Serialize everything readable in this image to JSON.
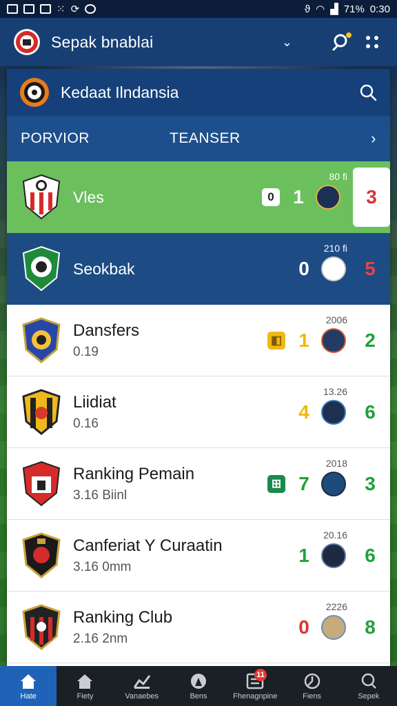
{
  "status_bar": {
    "battery": "71%",
    "time": "0:30"
  },
  "app_bar": {
    "title": "Sepak bnablai"
  },
  "league": {
    "title": "Kedaat Ilndansia"
  },
  "tabs": {
    "left": "PORVIOR",
    "right": "TEANSER"
  },
  "matches": [
    {
      "name": "Vles",
      "sub": "",
      "year": "80 fi",
      "badge": "0",
      "score1": "1",
      "score2": "3",
      "style": "green"
    },
    {
      "name": "Seokbak",
      "sub": "",
      "year": "210 fi",
      "badge": "",
      "score1": "0",
      "score2": "5",
      "style": "blue"
    },
    {
      "name": "Dansfers",
      "sub": "0.19",
      "year": "2006",
      "badge": "",
      "score1": "1",
      "score2": "2",
      "style": "white"
    },
    {
      "name": "Liidiat",
      "sub": "0.16",
      "year": "13.26",
      "badge": "",
      "score1": "4",
      "score2": "6",
      "style": "white"
    },
    {
      "name": "Ranking Pemain",
      "sub": "3.16  Biinl",
      "year": "2018",
      "badge": "",
      "score1": "7",
      "score2": "3",
      "style": "white"
    },
    {
      "name": "Canferiat Y Curaatin",
      "sub": "3.16  0mm",
      "year": "20.16",
      "badge": "",
      "score1": "1",
      "score2": "6",
      "style": "white"
    },
    {
      "name": "Ranking Club",
      "sub": "2.16  2nm",
      "year": "2226",
      "badge": "",
      "score1": "0",
      "score2": "8",
      "style": "white"
    }
  ],
  "bottom_nav": [
    {
      "label": "Hate"
    },
    {
      "label": "Fiety"
    },
    {
      "label": "Vanaebes"
    },
    {
      "label": "Bens"
    },
    {
      "label": "Fhenagnpine",
      "badge": "11"
    },
    {
      "label": "Fiens"
    },
    {
      "label": "Sepek"
    }
  ],
  "colors": {
    "app_bar": "#173f74",
    "header": "#16407a",
    "tabs": "#1d4f8c",
    "green_row": "#6bbf5d",
    "blue_row": "#1d4b84",
    "win": "#1fa23a",
    "loss": "#d93434",
    "draw": "#f1b814",
    "nav_active": "#1e63b8"
  }
}
